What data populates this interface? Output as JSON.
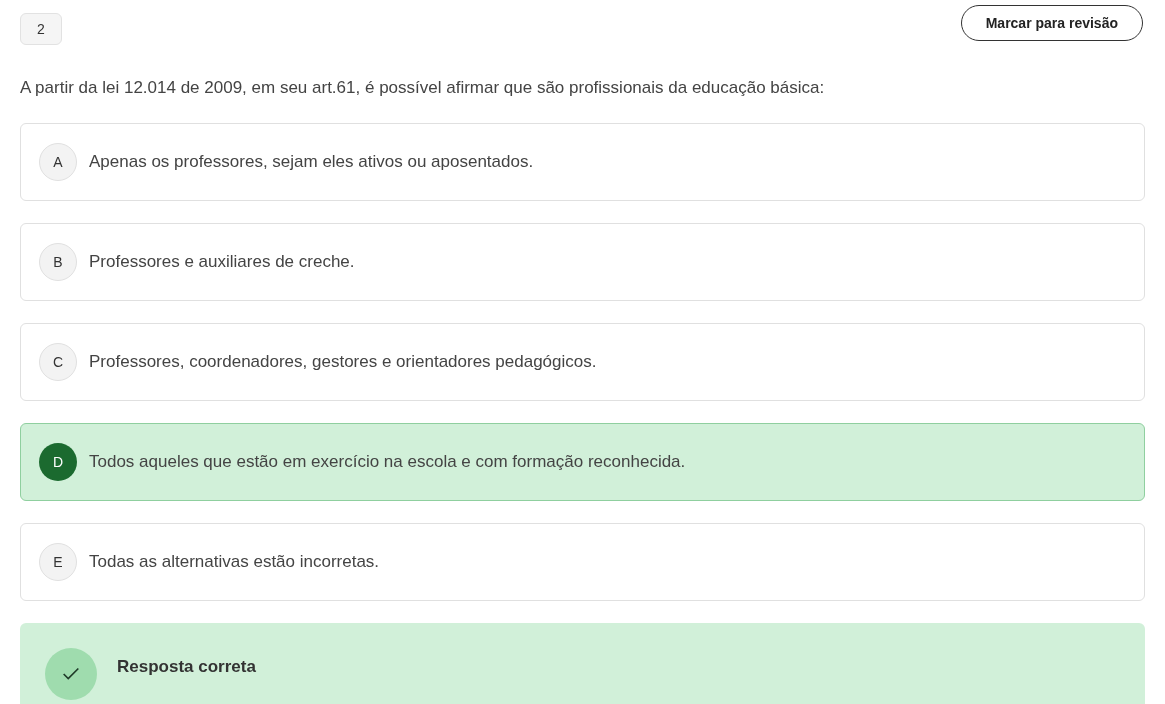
{
  "question": {
    "number": "2",
    "review_button": "Marcar para revisão",
    "text": "A partir da lei 12.014 de 2009, em seu art.61, é possível afirmar que são profissionais da educação básica:"
  },
  "options": [
    {
      "letter": "A",
      "text": "Apenas os professores, sejam eles ativos ou aposentados.",
      "selected": false
    },
    {
      "letter": "B",
      "text": "Professores e auxiliares de creche.",
      "selected": false
    },
    {
      "letter": "C",
      "text": "Professores, coordenadores, gestores e orientadores pedagógicos.",
      "selected": false
    },
    {
      "letter": "D",
      "text": "Todos aqueles que estão em exercício na escola e com formação reconhecida.",
      "selected": true
    },
    {
      "letter": "E",
      "text": "Todas as alternativas estão incorretas.",
      "selected": false
    }
  ],
  "feedback": {
    "kind": "correct",
    "title": "Resposta correta"
  }
}
